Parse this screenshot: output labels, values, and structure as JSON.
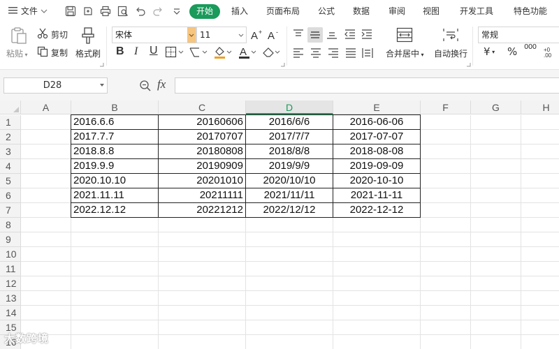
{
  "menubar": {
    "file_label": "文件",
    "tabs": [
      "开始",
      "插入",
      "页面布局",
      "公式",
      "数据",
      "审阅",
      "视图",
      "开发工具",
      "特色功能"
    ],
    "active_tab": "开始"
  },
  "ribbon": {
    "paste_label": "粘贴",
    "cut_label": "剪切",
    "copy_label": "复制",
    "format_painter_label": "格式刷",
    "font_name": "宋体",
    "font_size": "11",
    "merge_center_label": "合并居中",
    "wrap_text_label": "自动换行",
    "number_format": "常规",
    "currency_symbol": "¥",
    "percent_symbol": "%",
    "thousands_symbol": "000",
    "bold": "B",
    "italic": "I",
    "underline": "U",
    "accent_color": "#1a9a5b"
  },
  "formula_bar": {
    "name_box": "D28",
    "fx_label": "fx",
    "formula": ""
  },
  "grid": {
    "columns": [
      "A",
      "B",
      "C",
      "D",
      "E",
      "F",
      "G",
      "H"
    ],
    "selected_column": "D",
    "rows": [
      "1",
      "2",
      "3",
      "4",
      "5",
      "6",
      "7",
      "8",
      "9",
      "10",
      "11",
      "12",
      "13",
      "14",
      "15",
      "16"
    ],
    "data": [
      [
        "2016.6.6",
        "20160606",
        "2016/6/6",
        "2016-06-06"
      ],
      [
        "2017.7.7",
        "20170707",
        "2017/7/7",
        "2017-07-07"
      ],
      [
        "2018.8.8",
        "20180808",
        "2018/8/8",
        "2018-08-08"
      ],
      [
        "2019.9.9",
        "20190909",
        "2019/9/9",
        "2019-09-09"
      ],
      [
        "2020.10.10",
        "20201010",
        "2020/10/10",
        "2020-10-10"
      ],
      [
        "2021.11.11",
        "20211111",
        "2021/11/11",
        "2021-11-11"
      ],
      [
        "2022.12.12",
        "20221212",
        "2022/12/12",
        "2022-12-12"
      ]
    ]
  },
  "watermark": "大数跨境"
}
